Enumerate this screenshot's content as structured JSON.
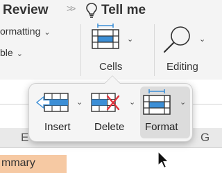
{
  "ribbon": {
    "tabs": {
      "review": "Review",
      "chevrons": ">>",
      "tell_me": "Tell me"
    },
    "options": {
      "formatting": "ormatting",
      "table": "ble"
    },
    "groups": {
      "cells": "Cells",
      "editing": "Editing"
    }
  },
  "cells_popover": {
    "items": [
      {
        "label": "Insert"
      },
      {
        "label": "Delete"
      },
      {
        "label": "Format",
        "selected": true
      }
    ]
  },
  "sheet": {
    "column_letters": [
      "E",
      "G"
    ],
    "cell_text": "mmary"
  },
  "colors": {
    "accent_blue": "#3d8fd6",
    "delete_red": "#e0303a",
    "summary_fill": "#f6c9a3"
  },
  "icons": [
    "lightbulb-icon",
    "cells-format-icon",
    "search-icon",
    "insert-cells-icon",
    "delete-cells-icon",
    "format-cells-icon",
    "pointer-cursor-icon"
  ]
}
